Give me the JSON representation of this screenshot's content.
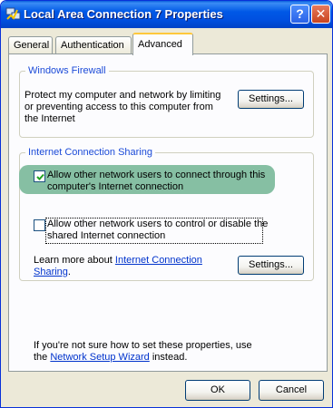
{
  "window": {
    "title": "Local Area Connection 7 Properties",
    "help_glyph": "?",
    "close_glyph": "✕"
  },
  "tabs": [
    {
      "label": "General",
      "selected": false
    },
    {
      "label": "Authentication",
      "selected": false
    },
    {
      "label": "Advanced",
      "selected": true
    }
  ],
  "firewall": {
    "title": "Windows Firewall",
    "description_line1": "Protect my computer and network by limiting",
    "description_line2": "or preventing access to this computer from",
    "description_line3": "the Internet",
    "settings_label": "Settings..."
  },
  "ics": {
    "title": "Internet Connection Sharing",
    "allow_connect": {
      "checked": true,
      "line1": "Allow other network users to connect through this",
      "line2": "computer's Internet connection"
    },
    "allow_control": {
      "checked": false,
      "line1": "Allow other network users to control or disable the",
      "line2": "shared Internet connection"
    },
    "learn_prefix": "Learn more about ",
    "learn_link_line1": "Internet Connection",
    "learn_link_line2": "Sharing",
    "learn_suffix": ".",
    "settings_label": "Settings..."
  },
  "footer_note": {
    "line1": "If you're not sure how to set these properties, use",
    "line2_prefix": "the ",
    "link": "Network Setup Wizard",
    "line2_suffix": " instead."
  },
  "buttons": {
    "ok": "OK",
    "cancel": "Cancel"
  },
  "colors": {
    "titlebar": "#0054e3",
    "group_title": "#1c4bd8",
    "link": "#0033cc",
    "highlight": "#86bfa3"
  }
}
